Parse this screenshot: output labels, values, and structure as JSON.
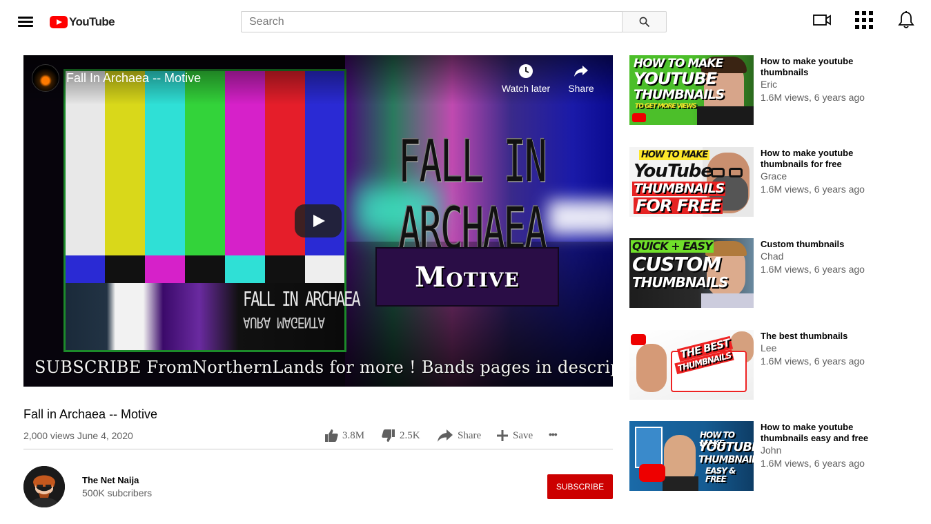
{
  "header": {
    "logo_text": "YouTube",
    "search_placeholder": "Search",
    "search_value": ""
  },
  "player": {
    "title": "Fall In Archaea -- Motive",
    "watch_later_label": "Watch later",
    "share_label": "Share",
    "art_title": "FALL IN ARCHAEA",
    "art_subtitle": "Motive",
    "album_line1": "FALL IN ARCHAEA",
    "album_line2": "AURA MAGENTA",
    "banner": "SUBSCRIBE FromNorthernLands for more ! Bands pages in description !"
  },
  "video": {
    "title": "Fall in Archaea -- Motive",
    "meta": "2,000 views June 4, 2020",
    "likes": "3.8M",
    "dislikes": "2.5K",
    "share_label": "Share",
    "save_label": "Save",
    "more_label": "•••"
  },
  "owner": {
    "name": "The Net Naija",
    "subscribers": "500K subcribers",
    "subscribe_label": "SUBSCRIBE"
  },
  "recommendations": [
    {
      "title": "How to make youtube thumbnails",
      "channel": "Eric",
      "meta": "1.6M views, 6 years ago",
      "thumb_lines": [
        "HOW TO MAKE",
        "YOUTUBE",
        "THUMBNAILS",
        "TO GET MORE VIEWS"
      ]
    },
    {
      "title": "How to make youtube thumbnails for free",
      "channel": "Grace",
      "meta": "1.6M views, 6 years ago",
      "thumb_lines": [
        "HOW TO MAKE",
        "YouTube",
        "THUMBNAILS",
        "FOR FREE"
      ]
    },
    {
      "title": "Custom thumbnails",
      "channel": "Chad",
      "meta": "1.6M views, 6 years ago",
      "thumb_lines": [
        "QUICK + EASY",
        "CUSTOM",
        "THUMBNAILS"
      ]
    },
    {
      "title": "The best thumbnails",
      "channel": "Lee",
      "meta": "1.6M views, 6 years ago",
      "thumb_lines": [
        "THE BEST",
        "THUMBNAILS"
      ]
    },
    {
      "title": "How to make youtube thumbnails easy and free",
      "channel": "John",
      "meta": "1.6M views, 6 years ago",
      "thumb_lines": [
        "HOW TO MAKE",
        "YOUTUBE",
        "THUMBNAILS",
        "EASY & FREE"
      ]
    }
  ],
  "colors": {
    "brand_red": "#ff0000",
    "subscribe_red": "#cc0000",
    "meta_gray": "#606060"
  }
}
